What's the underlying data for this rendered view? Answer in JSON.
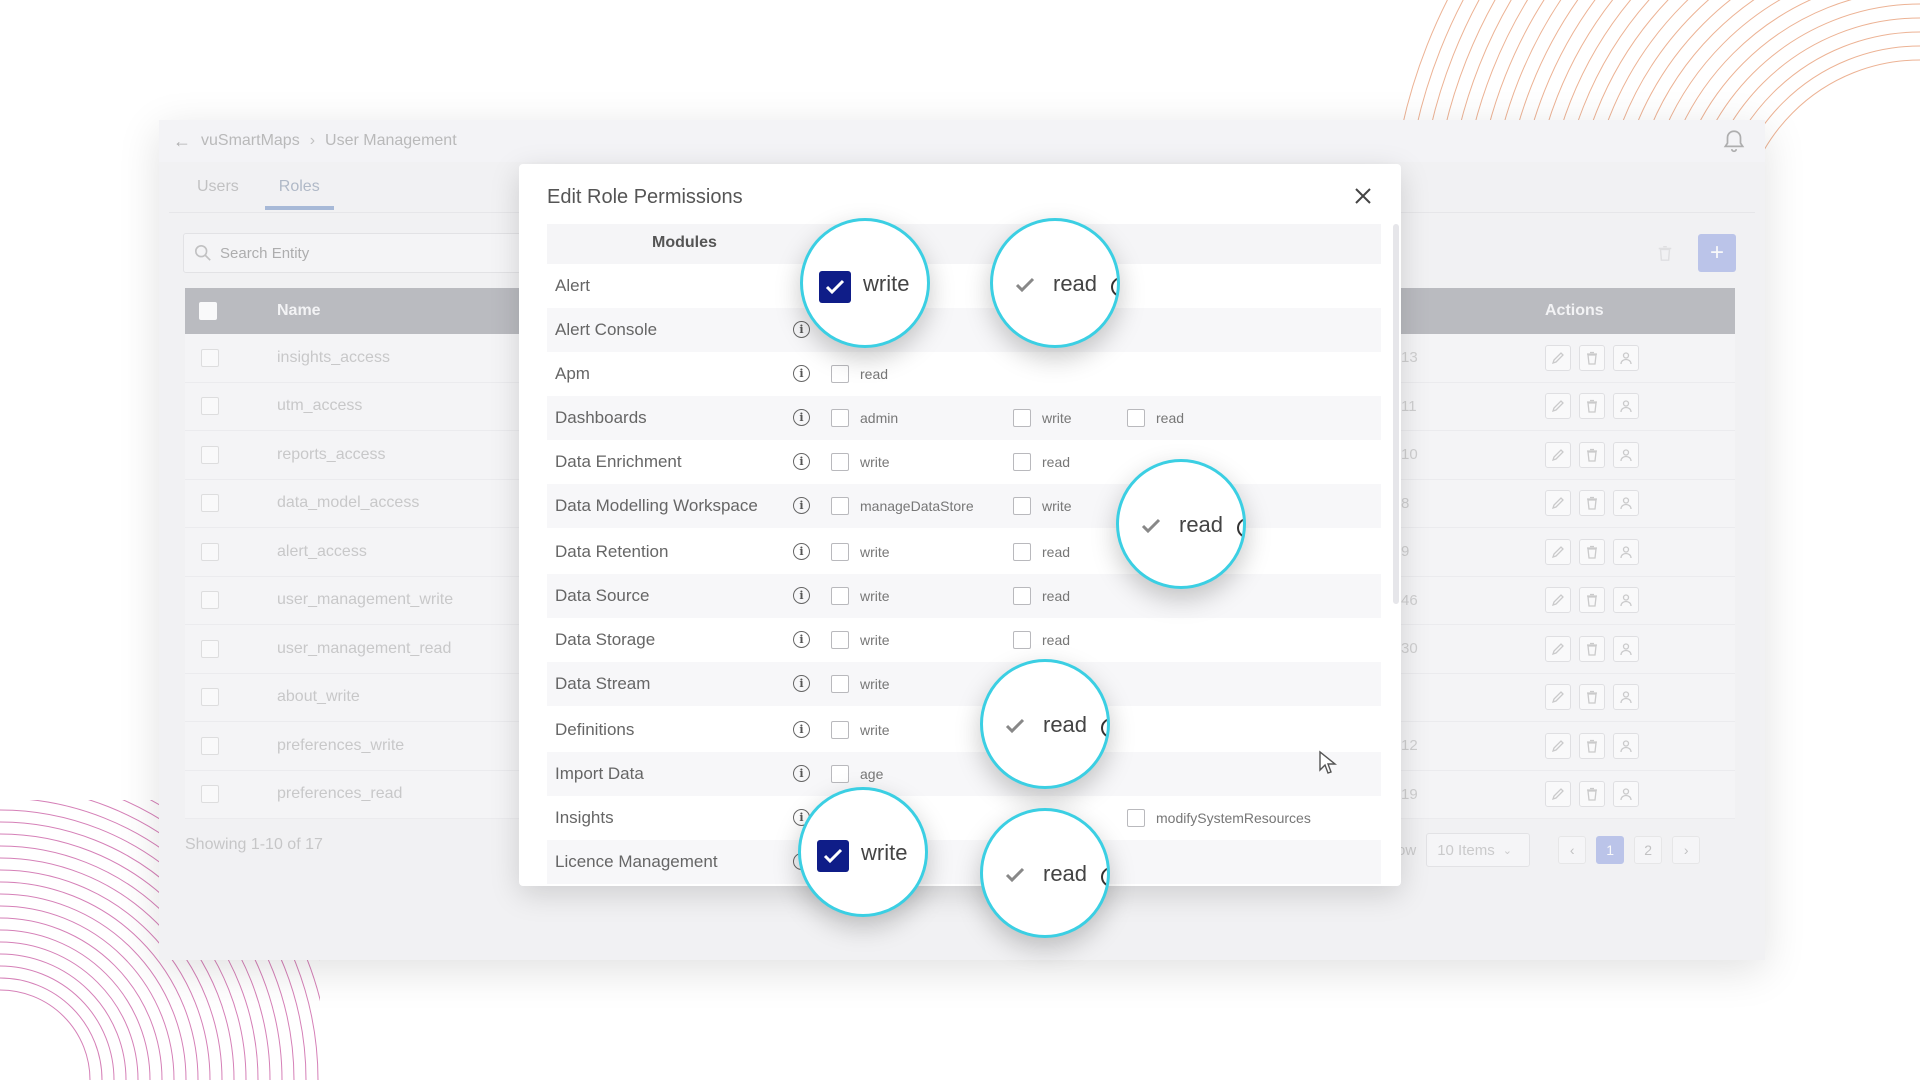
{
  "app": {
    "breadcrumb": {
      "root": "vuSmartMaps",
      "current": "User Management"
    },
    "tabs": [
      {
        "label": "Users"
      },
      {
        "label": "Roles"
      }
    ],
    "search_placeholder": "Search Entity",
    "table": {
      "columns": {
        "name": "Name",
        "actions": "Actions"
      },
      "rows": [
        {
          "name": "insights_access",
          "count": "13"
        },
        {
          "name": "utm_access",
          "count": "11"
        },
        {
          "name": "reports_access",
          "count": "10"
        },
        {
          "name": "data_model_access",
          "count": "8"
        },
        {
          "name": "alert_access",
          "count": "9"
        },
        {
          "name": "user_management_write",
          "count": "46"
        },
        {
          "name": "user_management_read",
          "count": "30"
        },
        {
          "name": "about_write",
          "count": ""
        },
        {
          "name": "preferences_write",
          "count": "12"
        },
        {
          "name": "preferences_read",
          "count": "19"
        }
      ]
    },
    "showing": "Showing 1-10 of 17",
    "pagination": {
      "show_label": "ow",
      "page_size": "10 Items",
      "prev": "‹",
      "next": "›",
      "pages": [
        "1",
        "2"
      ]
    }
  },
  "modal": {
    "title": "Edit Role Permissions",
    "columns": {
      "modules": "Modules",
      "permission": "ion"
    },
    "rows": [
      {
        "module": "Alert",
        "options": []
      },
      {
        "module": "Alert Console",
        "options": []
      },
      {
        "module": "Apm",
        "options": [
          "read"
        ]
      },
      {
        "module": "Dashboards",
        "options": [
          "admin",
          "write",
          "read"
        ]
      },
      {
        "module": "Data Enrichment",
        "options": [
          "write",
          "read"
        ]
      },
      {
        "module": "Data Modelling Workspace",
        "options": [
          "manageDataStore",
          "write"
        ]
      },
      {
        "module": "Data Retention",
        "options": [
          "write",
          "read"
        ]
      },
      {
        "module": "Data Source",
        "options": [
          "write",
          "read"
        ]
      },
      {
        "module": "Data Storage",
        "options": [
          "write",
          "read"
        ]
      },
      {
        "module": "Data Stream",
        "options": [
          "write"
        ]
      },
      {
        "module": "Definitions",
        "options": [
          "write"
        ]
      },
      {
        "module": "Import Data",
        "options": [
          "age"
        ]
      },
      {
        "module": "Insights",
        "options": [
          "modifySystemResources"
        ]
      },
      {
        "module": "Licence Management",
        "options": []
      }
    ]
  },
  "magnifiers": {
    "alert_write": {
      "label": "write",
      "checked": true,
      "style": "filled"
    },
    "alert_read": {
      "label": "read",
      "checked": true,
      "style": "tick"
    },
    "dmw_read": {
      "label": "read",
      "checked": true,
      "style": "tick"
    },
    "stream_read": {
      "label": "read",
      "checked": true,
      "style": "tick"
    },
    "insights_write": {
      "label": "write",
      "checked": true,
      "style": "filled"
    },
    "insights_read": {
      "label": "read",
      "checked": true,
      "style": "tick"
    }
  },
  "colors": {
    "accent": "#3bcfe3",
    "checkbox_fill": "#0f1d88",
    "primary_button": "#8e9fe0"
  }
}
